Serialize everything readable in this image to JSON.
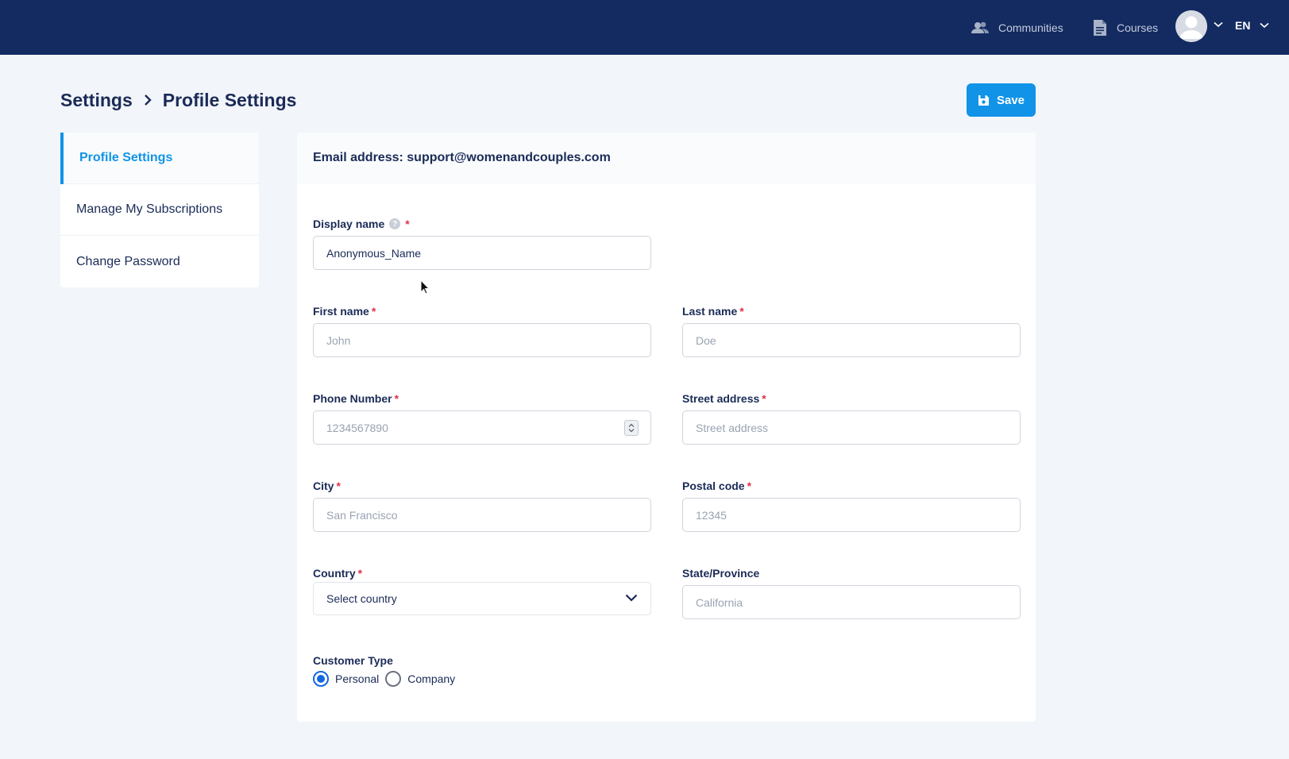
{
  "topbar": {
    "communities_label": "Communities",
    "courses_label": "Courses",
    "language": "EN"
  },
  "breadcrumb": {
    "root": "Settings",
    "current": "Profile Settings"
  },
  "actions": {
    "save_label": "Save"
  },
  "sidebar": {
    "items": [
      {
        "label": "Profile Settings",
        "active": true
      },
      {
        "label": "Manage My Subscriptions",
        "active": false
      },
      {
        "label": "Change Password",
        "active": false
      }
    ]
  },
  "form": {
    "email_header": "Email address: support@womenandcouples.com",
    "display_name": {
      "label": "Display name",
      "value": "Anonymous_Name",
      "help": "?"
    },
    "first_name": {
      "label": "First name",
      "placeholder": "John"
    },
    "last_name": {
      "label": "Last name",
      "placeholder": "Doe"
    },
    "phone": {
      "label": "Phone Number",
      "placeholder": "1234567890"
    },
    "street": {
      "label": "Street address",
      "placeholder": "Street address"
    },
    "city": {
      "label": "City",
      "placeholder": "San Francisco"
    },
    "postal": {
      "label": "Postal code",
      "placeholder": "12345"
    },
    "country": {
      "label": "Country",
      "selected": "Select country"
    },
    "state": {
      "label": "State/Province",
      "placeholder": "California"
    },
    "customer_type": {
      "label": "Customer Type",
      "options": [
        "Personal",
        "Company"
      ],
      "selected": "Personal"
    },
    "required_mark": "*"
  },
  "colors": {
    "topbar": "#142b61",
    "accent": "#1193e8",
    "required": "#e0334a",
    "radio_checked": "#1368e0"
  }
}
